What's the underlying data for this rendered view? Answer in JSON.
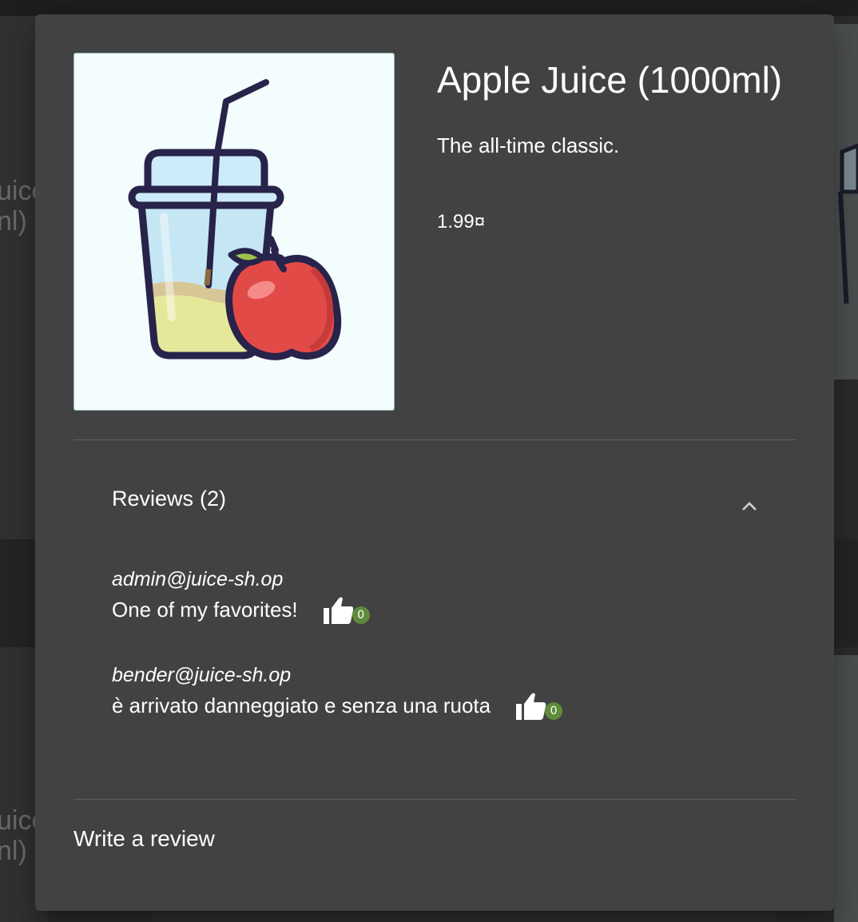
{
  "background": {
    "card_left_top_lines": [
      "uice",
      "nl)"
    ],
    "card_left_bottom_lines": [
      "uice",
      "nl)"
    ]
  },
  "product": {
    "title": "Apple Juice (1000ml)",
    "description": "The all-time classic.",
    "price": "1.99¤",
    "image_icon": "apple-juice-cup-illustration"
  },
  "reviews": {
    "label": "Reviews",
    "count": "(2)",
    "expanded": true,
    "toggle_icon": "chevron-up-icon",
    "items": [
      {
        "author": "admin@juice-sh.op",
        "text": "One of my favorites!",
        "likes": "0",
        "like_icon": "thumbs-up-icon"
      },
      {
        "author": "bender@juice-sh.op",
        "text": "è arrivato danneggiato e senza una ruota",
        "likes": "0",
        "like_icon": "thumbs-up-icon"
      }
    ]
  },
  "write_review": {
    "label": "Write a review"
  },
  "colors": {
    "dialog_bg": "#424242",
    "text": "#ffffff",
    "like_badge": "#5f8a3a",
    "image_bg": "#f4fdfd"
  }
}
